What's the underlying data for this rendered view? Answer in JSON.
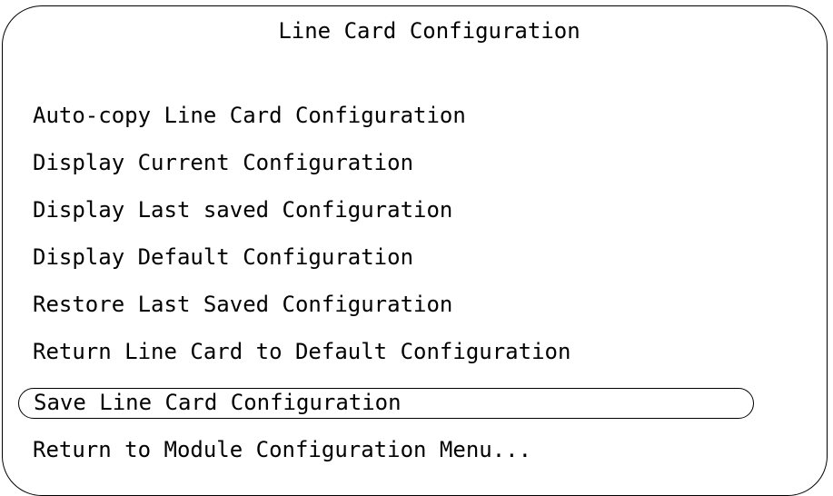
{
  "screen": {
    "title": "Line Card Configuration"
  },
  "menu": {
    "items": [
      {
        "label": "Auto-copy Line Card Configuration",
        "selected": false
      },
      {
        "label": "Display Current Configuration",
        "selected": false
      },
      {
        "label": "Display Last saved Configuration",
        "selected": false
      },
      {
        "label": "Display Default Configuration",
        "selected": false
      },
      {
        "label": "Restore Last Saved Configuration",
        "selected": false
      },
      {
        "label": "Return Line Card to Default Configuration",
        "selected": false
      },
      {
        "label": "Save Line Card Configuration",
        "selected": true
      },
      {
        "label": "Return to Module Configuration Menu...",
        "selected": false
      }
    ]
  }
}
